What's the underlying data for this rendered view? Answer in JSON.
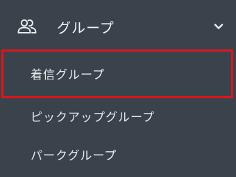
{
  "menu": {
    "header": {
      "label": "グループ",
      "icon": "users-icon",
      "chevron_icon": "chevron-down-icon",
      "expanded": true
    },
    "items": [
      {
        "label": "着信グループ",
        "selected": true
      },
      {
        "label": "ピックアップグループ",
        "selected": false
      },
      {
        "label": "パークグループ",
        "selected": false
      }
    ],
    "colors": {
      "background": "#3a434b",
      "text": "#e8ecef",
      "highlight_border": "#e0141c"
    }
  }
}
